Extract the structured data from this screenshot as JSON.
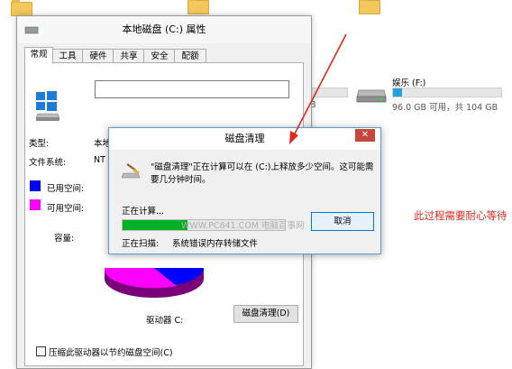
{
  "explorer": {
    "drive_f_label": "娱乐 (F:)",
    "drive_f_space": "96.0 GB 可用，共 104 GB",
    "drive_f_fill_percent": 8,
    "partial_text": "B"
  },
  "properties": {
    "title": "本地磁盘 (C:) 属性",
    "tabs": [
      "常规",
      "工具",
      "硬件",
      "共享",
      "安全",
      "配额"
    ],
    "active_tab": "常规",
    "type_label": "类型:",
    "type_value": "本地磁盘",
    "fs_label": "文件系统:",
    "fs_value": "NT",
    "used_label": "已用空间:",
    "free_label": "可用空间:",
    "capacity_label": "容量:",
    "drive_label": "驱动器 C:",
    "cleanup_button": "磁盘清理(D)",
    "compress_label": "压缩此驱动器以节约磁盘空间(C)",
    "colors": {
      "used": "#0000ff",
      "free": "#ff00ff"
    }
  },
  "dialog": {
    "title": "磁盘清理",
    "close_glyph": "✕",
    "message_line1": "\"磁盘清理\"正在计算可以在 (C:)上释放多少空间。这可能需",
    "message_line2": "要几分钟时间。",
    "calculating": "正在计算...",
    "progress_percent": 40,
    "watermark": "WWW.PC841.COM 电脑百事网",
    "cancel_button": "取消",
    "scanning_label": "正在扫描:",
    "scanning_value": "系统错误内存转储文件"
  },
  "annotation": "此过程需要耐心等待",
  "icons": [
    "folder-icon",
    "drive-icon",
    "cleanup-icon",
    "close-icon",
    "checkbox-icon"
  ]
}
